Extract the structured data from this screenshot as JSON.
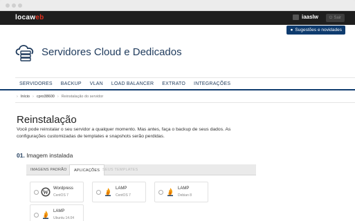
{
  "topbar": {
    "logo_main": "locaw",
    "logo_accent": "eb",
    "user_name": "iaaslw",
    "logout_label": "Sair"
  },
  "suggest_label": "Sugestões e novidades",
  "header": {
    "title": "Servidores Cloud e Dedicados"
  },
  "menu": [
    "SERVIDORES",
    "BACKUP",
    "VLAN",
    "LOAD BALANCER",
    "EXTRATO",
    "INTEGRAÇÕES"
  ],
  "breadcrumb": {
    "home": "Início",
    "server": "cpro38600",
    "current": "Reinstalação do servidor"
  },
  "main": {
    "title": "Reinstalação",
    "description": "Você pode reinstalar o seu servidor a qualquer momento. Mas antes, faça o backup de seus dados. As configurações customizadas de templates e snapshots serão perdidas.",
    "step_number": "01.",
    "step_label": "Imagem instalada"
  },
  "tabs": [
    {
      "label": "IMAGENS PADRÃO",
      "state": "normal"
    },
    {
      "label": "APLICAÇÕES",
      "state": "active"
    },
    {
      "label": "SEUS TEMPLATES",
      "state": "disabled"
    }
  ],
  "apps": [
    {
      "name": "Wordpress",
      "os": "CentOS 7",
      "icon": "wordpress-icon"
    },
    {
      "name": "LAMP",
      "os": "CentOS 7",
      "icon": "lamp-icon"
    },
    {
      "name": "LAMP",
      "os": "Debian 8",
      "icon": "lamp-icon"
    },
    {
      "name": "LAMP",
      "os": "Ubuntu 14.04",
      "icon": "lamp-icon"
    }
  ],
  "colors": {
    "brand": "#0e3b6e",
    "accent": "#e0301e",
    "topbar": "#1e1e1e"
  }
}
